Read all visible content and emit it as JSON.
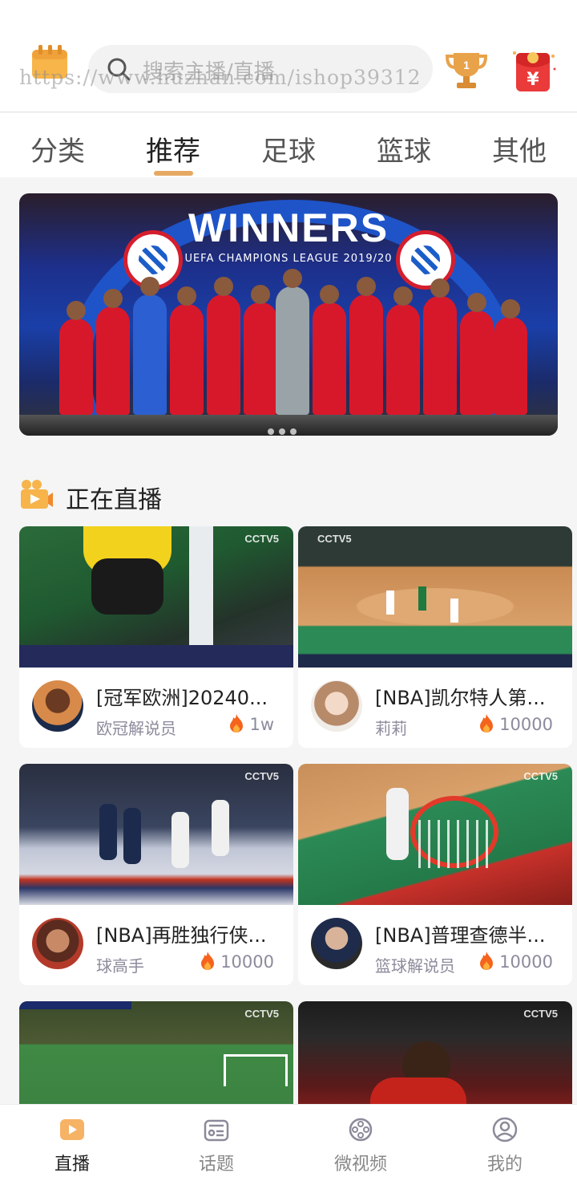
{
  "header": {
    "search_placeholder": "搜索主播/直播",
    "watermark": "https://www.huzhan.com/ishop39312",
    "icons": [
      "calendar-icon",
      "search-icon",
      "trophy-icon",
      "red-packet-icon"
    ],
    "trophy_rank": "1",
    "redpacket_symbol": "¥"
  },
  "tabs": [
    {
      "label": "分类",
      "active": false
    },
    {
      "label": "推荐",
      "active": true
    },
    {
      "label": "足球",
      "active": false
    },
    {
      "label": "篮球",
      "active": false
    },
    {
      "label": "其他",
      "active": false
    }
  ],
  "banner": {
    "title": "WINNERS",
    "subtitle": "UEFA CHAMPIONS LEAGUE 2019/20",
    "slide_count": 3
  },
  "live_section": {
    "title": "正在直播"
  },
  "cards": [
    {
      "title": "[冠军欧洲]20240...",
      "author": "欧冠解说员",
      "heat": "1w",
      "channel": "CCTV5"
    },
    {
      "title": "[NBA]凯尔特人第...",
      "author": "莉莉",
      "heat": "10000",
      "channel": "CCTV5"
    },
    {
      "title": "[NBA]再胜独行侠...",
      "author": "球高手",
      "heat": "10000",
      "channel": "CCTV5"
    },
    {
      "title": "[NBA]普理查德半...",
      "author": "篮球解说员",
      "heat": "10000",
      "channel": "CCTV5"
    },
    {
      "channel": "CCTV5"
    },
    {
      "channel": "CCTV5"
    }
  ],
  "bottom_nav": [
    {
      "label": "直播",
      "icon": "play-icon",
      "active": true
    },
    {
      "label": "话题",
      "icon": "topic-icon",
      "active": false
    },
    {
      "label": "微视频",
      "icon": "film-reel-icon",
      "active": false
    },
    {
      "label": "我的",
      "icon": "profile-icon",
      "active": false
    }
  ],
  "colors": {
    "accent": "#e6a964",
    "heat_fire": "#f5631d",
    "text_muted": "#8b8b9c"
  }
}
